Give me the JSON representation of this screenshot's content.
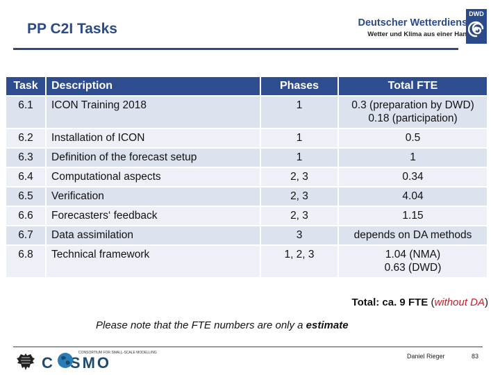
{
  "header": {
    "title": "PP C2I Tasks",
    "logo": {
      "name": "Deutscher Wetterdienst",
      "slogan": "Wetter und Klima aus einer Hand",
      "abbr": "DWD",
      "icon": "spiral-icon"
    }
  },
  "colors": {
    "title": "#2a4a8a",
    "table_header_bg": "#2e4d8f",
    "row_dark": "#dde3ee",
    "row_light": "#edf0f6",
    "accent_red": "#c0202a"
  },
  "table": {
    "headers": [
      "Task",
      "Description",
      "Phases",
      "Total FTE"
    ],
    "rows": [
      {
        "task": "6.1",
        "description": "ICON Training 2018",
        "phases": "1",
        "fte": [
          "0.3 (preparation by DWD)",
          "0.18 (participation)"
        ]
      },
      {
        "task": "6.2",
        "description": "Installation of ICON",
        "phases": "1",
        "fte": [
          "0.5"
        ]
      },
      {
        "task": "6.3",
        "description": "Definition of the forecast setup",
        "phases": "1",
        "fte": [
          "1"
        ]
      },
      {
        "task": "6.4",
        "description": "Computational aspects",
        "phases": "2, 3",
        "fte": [
          "0.34"
        ]
      },
      {
        "task": "6.5",
        "description": "Verification",
        "phases": "2, 3",
        "fte": [
          "4.04"
        ]
      },
      {
        "task": "6.6",
        "description": "Forecasters‘ feedback",
        "phases": "2, 3",
        "fte": [
          "1.15"
        ]
      },
      {
        "task": "6.7",
        "description": "Data assimilation",
        "phases": "3",
        "fte": [
          "depends on DA methods"
        ]
      },
      {
        "task": "6.8",
        "description": "Technical framework",
        "phases": "1, 2, 3",
        "fte": [
          "1.04 (NMA)",
          "0.63 (DWD)"
        ]
      }
    ]
  },
  "summary": {
    "total_prefix": "Total: ca. 9 FTE",
    "open_paren": " (",
    "total_note": "without DA",
    "close_paren": ")",
    "note_text": "Please note that the FTE numbers are only a ",
    "note_emphasis": "estimate"
  },
  "footer": {
    "consortium": "COSMO",
    "consortium_small": "CONSORTIUM FOR SMALL-SCALE MODELLING",
    "author": "Daniel Rieger",
    "page": "83"
  }
}
